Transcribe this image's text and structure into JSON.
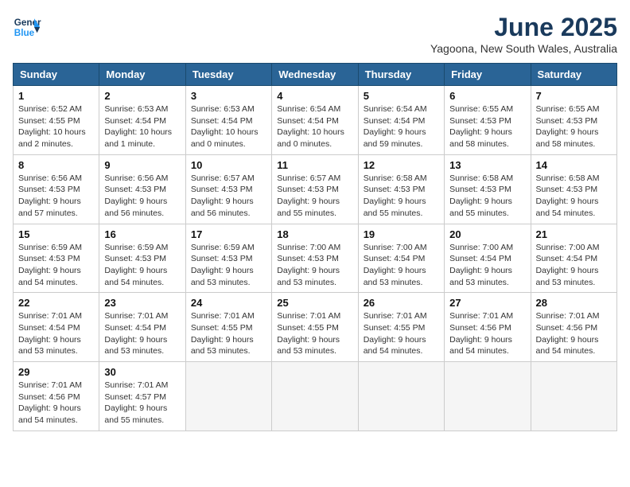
{
  "header": {
    "logo_line1": "General",
    "logo_line2": "Blue",
    "title": "June 2025",
    "subtitle": "Yagoona, New South Wales, Australia"
  },
  "columns": [
    "Sunday",
    "Monday",
    "Tuesday",
    "Wednesday",
    "Thursday",
    "Friday",
    "Saturday"
  ],
  "weeks": [
    {
      "shaded": false,
      "days": [
        {
          "num": "1",
          "info": "Sunrise: 6:52 AM\nSunset: 4:55 PM\nDaylight: 10 hours\nand 2 minutes."
        },
        {
          "num": "2",
          "info": "Sunrise: 6:53 AM\nSunset: 4:54 PM\nDaylight: 10 hours\nand 1 minute."
        },
        {
          "num": "3",
          "info": "Sunrise: 6:53 AM\nSunset: 4:54 PM\nDaylight: 10 hours\nand 0 minutes."
        },
        {
          "num": "4",
          "info": "Sunrise: 6:54 AM\nSunset: 4:54 PM\nDaylight: 10 hours\nand 0 minutes."
        },
        {
          "num": "5",
          "info": "Sunrise: 6:54 AM\nSunset: 4:54 PM\nDaylight: 9 hours\nand 59 minutes."
        },
        {
          "num": "6",
          "info": "Sunrise: 6:55 AM\nSunset: 4:53 PM\nDaylight: 9 hours\nand 58 minutes."
        },
        {
          "num": "7",
          "info": "Sunrise: 6:55 AM\nSunset: 4:53 PM\nDaylight: 9 hours\nand 58 minutes."
        }
      ]
    },
    {
      "shaded": true,
      "days": [
        {
          "num": "8",
          "info": "Sunrise: 6:56 AM\nSunset: 4:53 PM\nDaylight: 9 hours\nand 57 minutes."
        },
        {
          "num": "9",
          "info": "Sunrise: 6:56 AM\nSunset: 4:53 PM\nDaylight: 9 hours\nand 56 minutes."
        },
        {
          "num": "10",
          "info": "Sunrise: 6:57 AM\nSunset: 4:53 PM\nDaylight: 9 hours\nand 56 minutes."
        },
        {
          "num": "11",
          "info": "Sunrise: 6:57 AM\nSunset: 4:53 PM\nDaylight: 9 hours\nand 55 minutes."
        },
        {
          "num": "12",
          "info": "Sunrise: 6:58 AM\nSunset: 4:53 PM\nDaylight: 9 hours\nand 55 minutes."
        },
        {
          "num": "13",
          "info": "Sunrise: 6:58 AM\nSunset: 4:53 PM\nDaylight: 9 hours\nand 55 minutes."
        },
        {
          "num": "14",
          "info": "Sunrise: 6:58 AM\nSunset: 4:53 PM\nDaylight: 9 hours\nand 54 minutes."
        }
      ]
    },
    {
      "shaded": false,
      "days": [
        {
          "num": "15",
          "info": "Sunrise: 6:59 AM\nSunset: 4:53 PM\nDaylight: 9 hours\nand 54 minutes."
        },
        {
          "num": "16",
          "info": "Sunrise: 6:59 AM\nSunset: 4:53 PM\nDaylight: 9 hours\nand 54 minutes."
        },
        {
          "num": "17",
          "info": "Sunrise: 6:59 AM\nSunset: 4:53 PM\nDaylight: 9 hours\nand 53 minutes."
        },
        {
          "num": "18",
          "info": "Sunrise: 7:00 AM\nSunset: 4:53 PM\nDaylight: 9 hours\nand 53 minutes."
        },
        {
          "num": "19",
          "info": "Sunrise: 7:00 AM\nSunset: 4:54 PM\nDaylight: 9 hours\nand 53 minutes."
        },
        {
          "num": "20",
          "info": "Sunrise: 7:00 AM\nSunset: 4:54 PM\nDaylight: 9 hours\nand 53 minutes."
        },
        {
          "num": "21",
          "info": "Sunrise: 7:00 AM\nSunset: 4:54 PM\nDaylight: 9 hours\nand 53 minutes."
        }
      ]
    },
    {
      "shaded": true,
      "days": [
        {
          "num": "22",
          "info": "Sunrise: 7:01 AM\nSunset: 4:54 PM\nDaylight: 9 hours\nand 53 minutes."
        },
        {
          "num": "23",
          "info": "Sunrise: 7:01 AM\nSunset: 4:54 PM\nDaylight: 9 hours\nand 53 minutes."
        },
        {
          "num": "24",
          "info": "Sunrise: 7:01 AM\nSunset: 4:55 PM\nDaylight: 9 hours\nand 53 minutes."
        },
        {
          "num": "25",
          "info": "Sunrise: 7:01 AM\nSunset: 4:55 PM\nDaylight: 9 hours\nand 53 minutes."
        },
        {
          "num": "26",
          "info": "Sunrise: 7:01 AM\nSunset: 4:55 PM\nDaylight: 9 hours\nand 54 minutes."
        },
        {
          "num": "27",
          "info": "Sunrise: 7:01 AM\nSunset: 4:56 PM\nDaylight: 9 hours\nand 54 minutes."
        },
        {
          "num": "28",
          "info": "Sunrise: 7:01 AM\nSunset: 4:56 PM\nDaylight: 9 hours\nand 54 minutes."
        }
      ]
    },
    {
      "shaded": false,
      "days": [
        {
          "num": "29",
          "info": "Sunrise: 7:01 AM\nSunset: 4:56 PM\nDaylight: 9 hours\nand 54 minutes."
        },
        {
          "num": "30",
          "info": "Sunrise: 7:01 AM\nSunset: 4:57 PM\nDaylight: 9 hours\nand 55 minutes."
        },
        {
          "num": "",
          "info": ""
        },
        {
          "num": "",
          "info": ""
        },
        {
          "num": "",
          "info": ""
        },
        {
          "num": "",
          "info": ""
        },
        {
          "num": "",
          "info": ""
        }
      ]
    }
  ]
}
